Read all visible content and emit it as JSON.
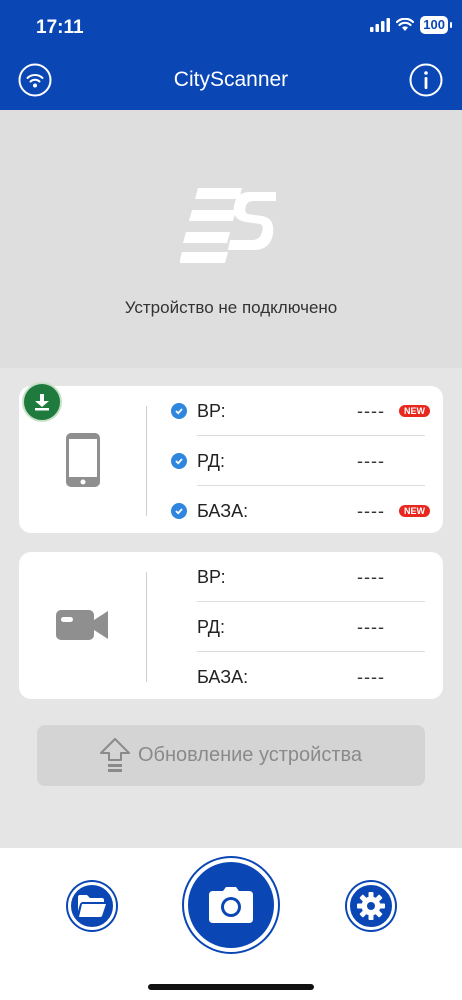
{
  "status_bar": {
    "time": "17:11",
    "battery": "100"
  },
  "header": {
    "title": "CityScanner"
  },
  "hero": {
    "connection_status": "Устройство не подключено"
  },
  "phone_card": {
    "rows": [
      {
        "label": "ВР:",
        "value": "----",
        "badge": "NEW"
      },
      {
        "label": "РД:",
        "value": "----",
        "badge": ""
      },
      {
        "label": "БАЗА:",
        "value": "----",
        "badge": "NEW"
      }
    ]
  },
  "camera_card": {
    "rows": [
      {
        "label": "ВР:",
        "value": "----"
      },
      {
        "label": "РД:",
        "value": "----"
      },
      {
        "label": "БАЗА:",
        "value": "----"
      }
    ]
  },
  "update_button": {
    "label": "Обновление устройства"
  },
  "colors": {
    "primary": "#0a47b5",
    "download_badge": "#1f7a3d",
    "new_badge": "#e8281e",
    "check": "#2e86de"
  },
  "icons": [
    "wifi-icon",
    "info-icon",
    "download-icon",
    "phone-icon",
    "video-camera-icon",
    "upload-icon",
    "folder-icon",
    "camera-icon",
    "gear-icon"
  ]
}
